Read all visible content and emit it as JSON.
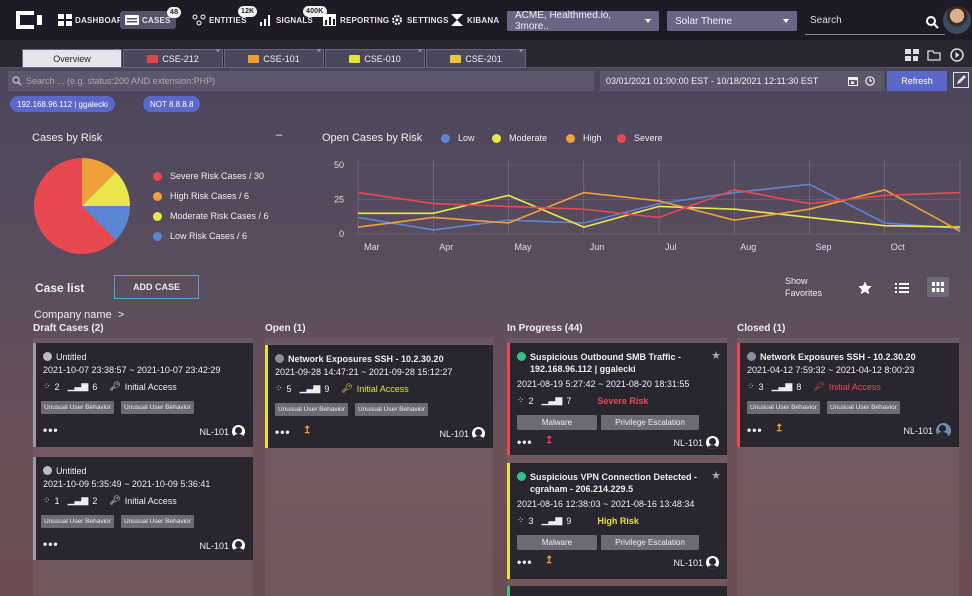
{
  "nav": {
    "items": [
      {
        "label": "DASHBOARD",
        "icon": "grid-icon"
      },
      {
        "label": "CASES",
        "icon": "cases-icon",
        "badge": "48"
      },
      {
        "label": "ENTITIES",
        "icon": "entities-icon",
        "badge": "12K"
      },
      {
        "label": "SIGNALS",
        "icon": "signals-icon",
        "badge": "400K"
      },
      {
        "label": "REPORTING",
        "icon": "chart-icon"
      },
      {
        "label": "SETTINGS",
        "icon": "gear-icon"
      },
      {
        "label": "KIBANA",
        "icon": "kibana-icon"
      }
    ],
    "org_select": "ACME, Healthmed.io, 3more..",
    "theme_select": "Solar Theme",
    "search_placeholder": "Search"
  },
  "tabs": [
    {
      "label": "Overview",
      "active": true
    },
    {
      "label": "CSE-212",
      "color": "#e0454b"
    },
    {
      "label": "CSE-101",
      "color": "#f0a030"
    },
    {
      "label": "CSE-010",
      "color": "#e6e23a"
    },
    {
      "label": "CSE-201",
      "color": "#e6c63a"
    }
  ],
  "query": {
    "placeholder": "Search ... (e.g. status:200 AND extension:PHP)",
    "date_range": "03/01/2021 01:00:00 EST - 10/18/2021 12:11:30 EST",
    "refresh_label": "Refresh",
    "filters": [
      "192.168.96.112 | ggalecki",
      "NOT 8.8.8.8"
    ]
  },
  "pie": {
    "title": "Cases by Risk",
    "colors": {
      "severe": "#e8484f",
      "high": "#f0a03a",
      "moderate": "#e9e64a",
      "low": "#5b86d4"
    },
    "legend": [
      {
        "label": "Severe Risk Cases / 30",
        "color": "#e8484f"
      },
      {
        "label": "High Risk Cases / 6",
        "color": "#f0a03a"
      },
      {
        "label": "Moderate Risk Cases / 6",
        "color": "#e9e64a"
      },
      {
        "label": "Low Risk Cases / 6",
        "color": "#5b86d4"
      }
    ],
    "collapse_label": "–"
  },
  "chart_data": [
    {
      "type": "pie",
      "title": "Cases by Risk",
      "labels": [
        "Severe Risk Cases",
        "High Risk Cases",
        "Moderate Risk Cases",
        "Low Risk Cases"
      ],
      "values": [
        30,
        6,
        6,
        6
      ]
    },
    {
      "type": "line",
      "title": "Open Cases by Risk",
      "x": [
        "Mar",
        "Apr",
        "May",
        "Jun",
        "Jul",
        "Aug",
        "Sep",
        "Oct"
      ],
      "ylim": [
        0,
        50
      ],
      "yticks": [
        0,
        25,
        50
      ],
      "grid": true,
      "legend_position": "top",
      "series": [
        {
          "name": "Low",
          "color": "#5b86d4",
          "values": [
            12,
            3,
            10,
            8,
            22,
            30,
            36,
            8,
            4
          ]
        },
        {
          "name": "Moderate",
          "color": "#e9e64a",
          "values": [
            15,
            15,
            28,
            5,
            20,
            18,
            12,
            6,
            5
          ]
        },
        {
          "name": "High",
          "color": "#f0a03a",
          "values": [
            5,
            12,
            8,
            30,
            24,
            10,
            18,
            32,
            2
          ]
        },
        {
          "name": "Severe",
          "color": "#e8484f",
          "values": [
            30,
            22,
            20,
            18,
            12,
            32,
            22,
            28,
            30
          ]
        }
      ]
    }
  ],
  "caselist": {
    "title": "Case list",
    "add_label": "ADD CASE",
    "show_favorites": "Show\nFavorites",
    "company": "Company name  >",
    "columns": [
      {
        "title": "Draft Cases (2)",
        "cards": [
          {
            "title": "Untitled",
            "dates": "2021-10-07  23:38:57 ~ 2021-10-07  23:42:29",
            "entities": "2",
            "signals": "6",
            "tactic": "Initial Access",
            "tags": [
              "Unusual User Behavior",
              "Unusual User Behavior"
            ],
            "owner": "NL-101",
            "stripe": "#9e9aa3"
          },
          {
            "title": "Untitled",
            "dates": "2021-10-09  5:35:49 ~ 2021-10-09  5:36:41",
            "entities": "1",
            "signals": "2",
            "tactic": "Initial Access",
            "tags": [
              "Unusual User Behavior",
              "Unusual User Behavior"
            ],
            "owner": "NL-101",
            "stripe": "#9e9aa3"
          }
        ]
      },
      {
        "title": "Open (1)",
        "cards": [
          {
            "title": "Network Exposures SSH - 10.2.30.20",
            "dates": "2021-09-28  14:47:21 ~ 2021-09-28  15:12:27",
            "entities": "5",
            "signals": "9",
            "tactic": "Initial Access",
            "tags": [
              "Unusual User Behavior",
              "Unusual User Behavior"
            ],
            "owner": "NL-101",
            "stripe": "#e6e23a"
          }
        ]
      },
      {
        "title": "In Progress (44)",
        "cards": [
          {
            "title": "Suspicious Outbound SMB Traffic - 192.168.96.112 | ggalecki",
            "dates": "2021-08-19  5:27:42 ~ 2021-08-20  18:31:55",
            "entities": "2",
            "signals": "7",
            "risk": "Severe Risk",
            "tags": [
              "Malware",
              "Privilege Escalation"
            ],
            "owner": "NL-101",
            "stripe": "#e8484f"
          },
          {
            "title": "Suspicious VPN Connection Detected - cgraham - 206.214.229.5",
            "dates": "2021-08-16  12:38:03 ~ 2021-08-16  13:48:34",
            "entities": "3",
            "signals": "9",
            "risk": "High Risk",
            "tags": [
              "Malware",
              "Privilege Escalation"
            ],
            "owner": "NL-101",
            "stripe": "#e6e23a"
          }
        ]
      },
      {
        "title": "Closed (1)",
        "cards": [
          {
            "title": "Network Exposures SSH - 10.2.30.20",
            "dates": "2021-04-12  7:59:32 ~ 2021-04-12  8:00:23",
            "entities": "3",
            "signals": "8",
            "tactic": "Initial Access",
            "tags": [
              "Unusual User Behavior",
              "Unusual User Behavior"
            ],
            "owner": "NL-101",
            "stripe": "#e8484f"
          }
        ]
      }
    ]
  }
}
